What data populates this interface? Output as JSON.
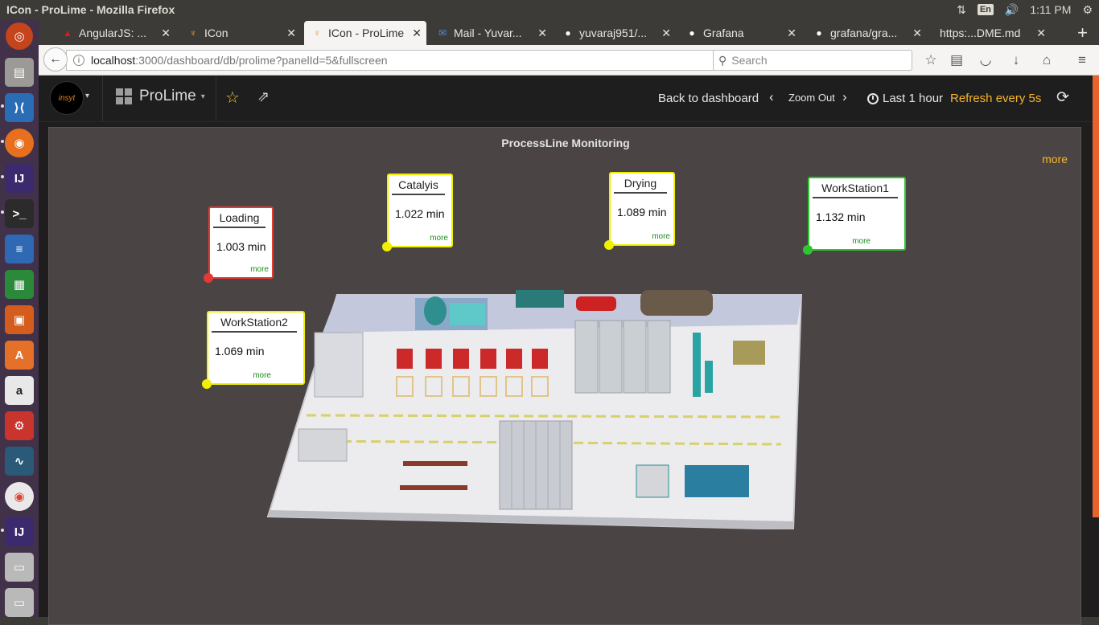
{
  "window": {
    "title": "ICon - ProLime - Mozilla Firefox"
  },
  "tray": {
    "lang": "En",
    "time": "1:11 PM"
  },
  "tabs": [
    {
      "label": "AngularJS: ...",
      "icon": "angular-icon",
      "color": "#dd1b16"
    },
    {
      "label": "ICon",
      "icon": "icon-app-icon",
      "color": "#e8a33b"
    },
    {
      "label": "ICon - ProLime",
      "icon": "icon-app-icon",
      "color": "#e8a33b",
      "active": true
    },
    {
      "label": "Mail - Yuvar...",
      "icon": "mail-icon",
      "color": "#0072c6"
    },
    {
      "label": "yuvaraj951/...",
      "icon": "github-icon",
      "color": "#ffffff"
    },
    {
      "label": "Grafana",
      "icon": "github-icon",
      "color": "#ffffff"
    },
    {
      "label": "grafana/gra...",
      "icon": "github-icon",
      "color": "#ffffff"
    },
    {
      "label": "https:...DME.md",
      "icon": "",
      "color": ""
    }
  ],
  "urlbar": {
    "host": "localhost",
    "path": ":3000/dashboard/db/prolime?panelId=5&fullscreen"
  },
  "search": {
    "placeholder": "Search"
  },
  "grafana": {
    "logo_text": "insyt",
    "dashboard_title": "ProLime",
    "back_label": "Back to dashboard",
    "zoom_label": "Zoom Out",
    "time_range": "Last 1 hour",
    "refresh_label": "Refresh every 5s"
  },
  "panel": {
    "title": "ProcessLine Monitoring",
    "more": "more",
    "stations": [
      {
        "name": "Loading",
        "value": "1.003 min",
        "more": "more",
        "status_color": "#e53935"
      },
      {
        "name": "Catalyis",
        "value": "1.022 min",
        "more": "more",
        "status_color": "#f0f000"
      },
      {
        "name": "Drying",
        "value": "1.089 min",
        "more": "more",
        "status_color": "#f0f000"
      },
      {
        "name": "WorkStation1",
        "value": "1.132 min",
        "more": "more",
        "status_color": "#2ec62e"
      },
      {
        "name": "WorkStation2",
        "value": "1.069 min",
        "more": "more",
        "status_color": "#f0f000"
      }
    ]
  },
  "colors": {
    "accent": "#f7b52c",
    "panel_bg": "#4a4544",
    "scrollbar": "#e8632b"
  }
}
